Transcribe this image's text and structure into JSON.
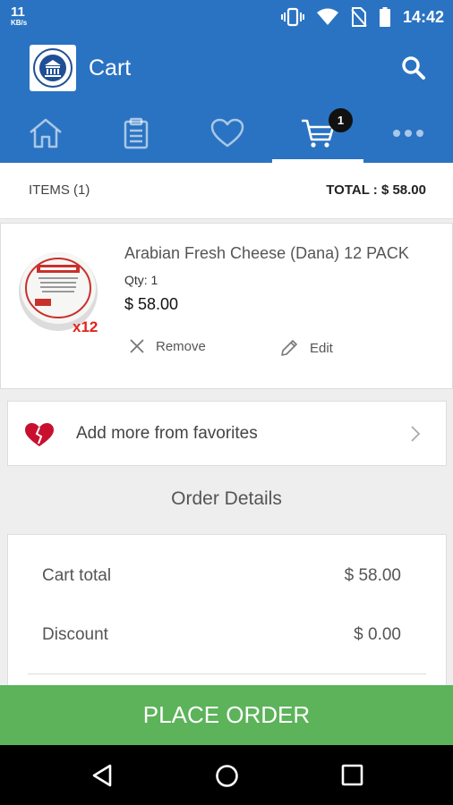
{
  "status_bar": {
    "net_speed": "11",
    "net_unit": "KB/s",
    "time": "14:42"
  },
  "app_bar": {
    "title": "Cart"
  },
  "tabs": [
    {
      "name": "home"
    },
    {
      "name": "orders"
    },
    {
      "name": "favorites"
    },
    {
      "name": "cart",
      "badge": "1",
      "active": true
    },
    {
      "name": "more"
    }
  ],
  "items_header": {
    "count_label": "ITEMS (1)",
    "total_label": "TOTAL : $ 58.00"
  },
  "cart_item": {
    "name": "Arabian Fresh Cheese (Dana) 12 PACK",
    "qty_label": "Qty: 1",
    "price": "$ 58.00",
    "image_badge": "x12",
    "remove_label": "Remove",
    "edit_label": "Edit"
  },
  "favorites_link": {
    "label": "Add more from favorites"
  },
  "order_details": {
    "title": "Order Details",
    "rows": [
      {
        "label": "Cart total",
        "value": "$ 58.00"
      },
      {
        "label": "Discount",
        "value": "$ 0.00"
      }
    ]
  },
  "place_order": {
    "label": "PLACE ORDER"
  },
  "colors": {
    "primary": "#2a73c2",
    "place_order": "#5cb35a",
    "heart": "#c8102e"
  }
}
